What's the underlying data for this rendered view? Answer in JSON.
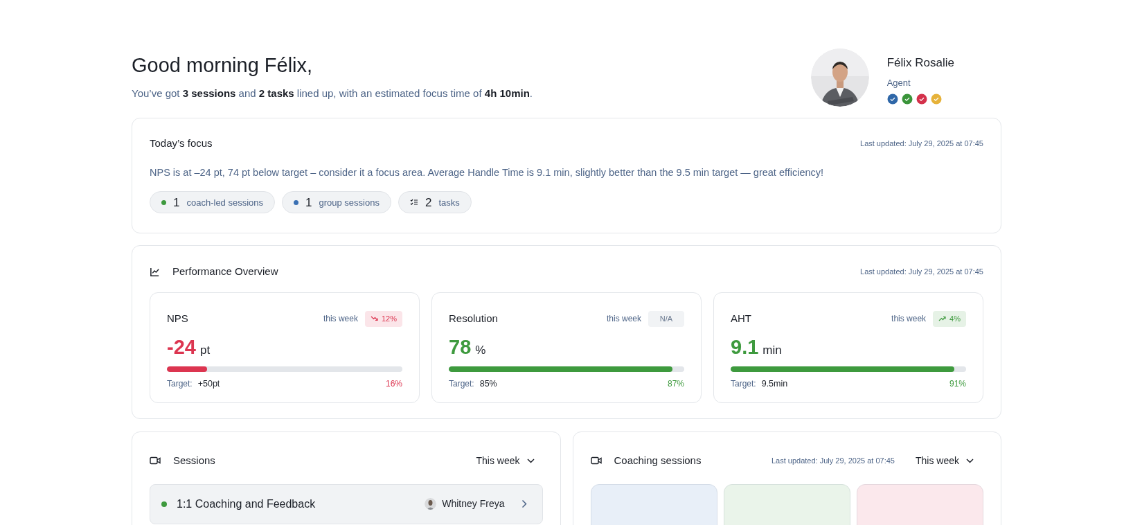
{
  "greeting": {
    "title": "Good morning Félix,",
    "summary": "You’ve got **3 sessions** and **2 tasks** lined up, with an estimated focus time of **4h 10min**."
  },
  "profile": {
    "name": "Félix Rosalie",
    "role": "Agent",
    "badges": [
      {
        "color": "#2f67a8"
      },
      {
        "color": "#3a943a"
      },
      {
        "color": "#d4314b"
      },
      {
        "color": "#e6b23a"
      }
    ]
  },
  "focus": {
    "title": "Today’s focus",
    "updated": "Last updated: July 29, 2025 at 07:45",
    "message": "NPS is at –24 pt, 74 pt below target – consider it a focus area. Average Handle Time is 9.1 min, slightly better than the 9.5 min target — great efficiency!",
    "chips": [
      {
        "kind": "dot",
        "color": "#3e9a3e",
        "count": "1",
        "label": "coach-led sessions"
      },
      {
        "kind": "dot",
        "color": "#3a70b3",
        "count": "1",
        "label": "group sessions"
      },
      {
        "kind": "tasks",
        "count": "2",
        "label": "tasks"
      }
    ]
  },
  "performance": {
    "title": "Performance Overview",
    "updated": "Last updated: July 29, 2025 at 07:45",
    "metrics": [
      {
        "name": "NPS",
        "period": "this week",
        "kind": "down",
        "change": "12%",
        "value": "-24",
        "unit": "pt",
        "color": "#dc3550",
        "level": 0.17,
        "target_label": "Target:",
        "target": "+50pt",
        "percent": "16%"
      },
      {
        "name": "Resolution",
        "period": "this week",
        "kind": "flat",
        "change": "N/A",
        "value": "78",
        "unit": "%",
        "color": "#3e9a3e",
        "level": 0.95,
        "target_label": "Target:",
        "target": "85%",
        "percent": "87%"
      },
      {
        "name": "AHT",
        "period": "this week",
        "kind": "up",
        "change": "4%",
        "value": "9.1",
        "unit": "min",
        "color": "#3e9a3e",
        "level": 0.95,
        "target_label": "Target:",
        "target": "9.5min",
        "percent": "91%"
      }
    ]
  },
  "sessions": {
    "title": "Sessions",
    "filter": "This week",
    "items": [
      {
        "color": "#3e9a3e",
        "title": "1:1 Coaching and Feedback",
        "person": "Whitney Freya"
      }
    ]
  },
  "coaching": {
    "title": "Coaching sessions",
    "updated": "Last updated: July 29, 2025 at 07:45",
    "filter": "This week",
    "stats": [
      {
        "color": "#e8eff8"
      },
      {
        "color": "#eaf4ea"
      },
      {
        "color": "#fbe8ec"
      }
    ]
  }
}
